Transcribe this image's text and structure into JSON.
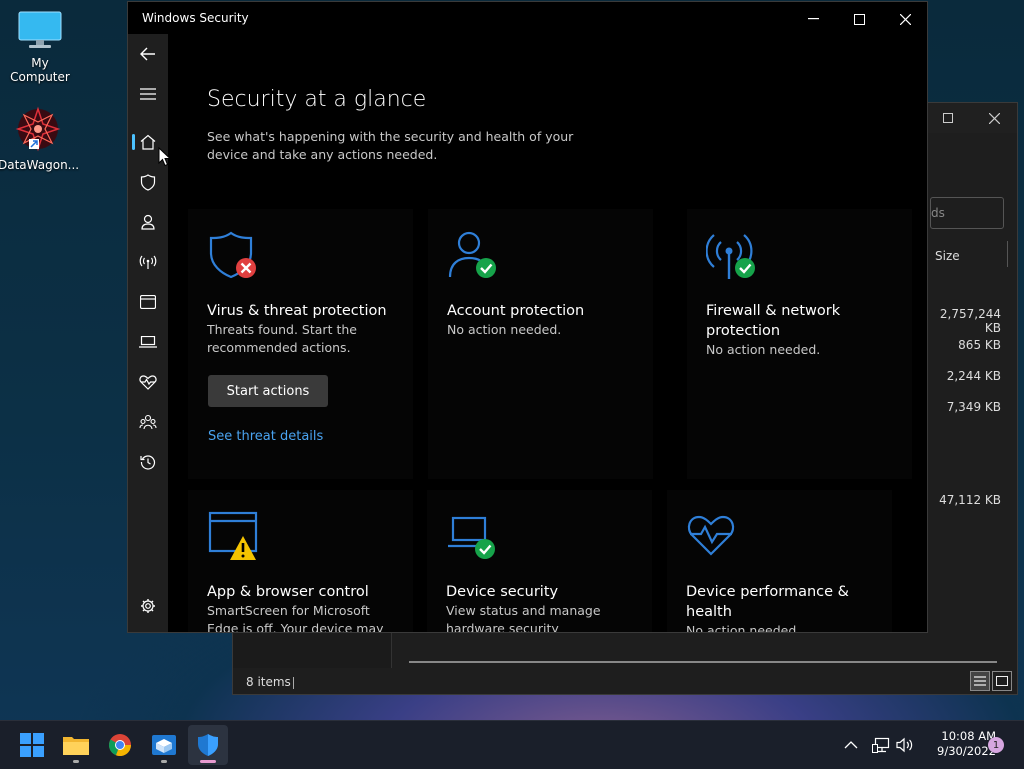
{
  "desktop": {
    "icons": [
      {
        "label": "My Computer"
      },
      {
        "label": "DataWagon..."
      }
    ]
  },
  "explorer": {
    "search_placeholder": "ds",
    "column_size": "Size",
    "sizes": [
      "2,757,244 KB",
      "865 KB",
      "2,244 KB",
      "7,349 KB",
      "47,112 KB"
    ],
    "status": "8 items"
  },
  "window": {
    "title": "Windows Security"
  },
  "page": {
    "title": "Security at a glance",
    "subtitle": "See what's happening with the security and health of your device and take any actions needed."
  },
  "tiles": {
    "virus": {
      "title": "Virus & threat protection",
      "desc": "Threats found. Start the recommended actions.",
      "button": "Start actions",
      "link": "See threat details"
    },
    "account": {
      "title": "Account protection",
      "desc": "No action needed."
    },
    "firewall": {
      "title": "Firewall & network protection",
      "desc": "No action needed."
    },
    "app": {
      "title": "App & browser control",
      "desc": "SmartScreen for Microsoft Edge is off. Your device may be"
    },
    "device": {
      "title": "Device security",
      "desc": "View status and manage hardware security features."
    },
    "perf": {
      "title": "Device performance & health",
      "desc": "No action needed."
    }
  },
  "taskbar": {
    "time": "10:08 AM",
    "date": "9/30/2022",
    "notifications": "1"
  },
  "colors": {
    "accent_blue": "#2f7fd8",
    "error_red": "#e04040",
    "ok_green": "#16a34a",
    "warning_yellow": "#f5c400",
    "link": "#4aa3f0"
  }
}
